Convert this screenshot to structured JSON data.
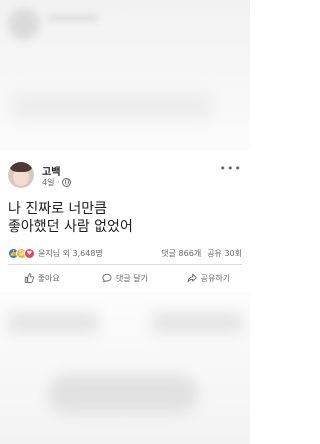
{
  "post": {
    "author": "고백",
    "meta": "4일 ·",
    "text": "나 진짜로 너만큼\n좋아했던 사람 없었어",
    "reaction_summary": "윤지님 외 3,648명",
    "comments_count": "댓글 866개",
    "shares_count": "공유 30회",
    "reactions": [
      "like",
      "haha",
      "love"
    ]
  },
  "actions": {
    "like": "좋아요",
    "comment": "댓글 달기",
    "share": "공유하기"
  },
  "colors": {
    "accent": "#1877f2",
    "text": "#1c1e21",
    "muted": "#65676b"
  }
}
